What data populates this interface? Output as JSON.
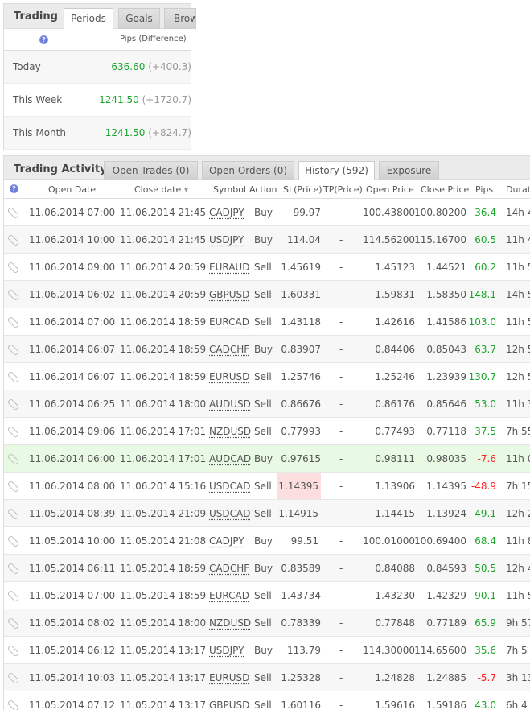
{
  "periods_panel": {
    "title": "Trading",
    "tabs": [
      "Periods",
      "Goals",
      "Brow"
    ],
    "active_tab": 0,
    "header": "Pips (Difference)",
    "rows": [
      {
        "label": "Today",
        "pips": "636.60",
        "diff": "(+400.3)"
      },
      {
        "label": "This Week",
        "pips": "1241.50",
        "diff": "(+1720.7)"
      },
      {
        "label": "This Month",
        "pips": "1241.50",
        "diff": "(+824.7)"
      }
    ]
  },
  "activity_panel": {
    "title": "Trading Activity",
    "tabs": [
      "Open Trades (0)",
      "Open Orders (0)",
      "History (592)",
      "Exposure"
    ],
    "active_tab": 2,
    "columns": [
      "Open Date",
      "Close date",
      "Symbol",
      "Action",
      "SL(Price)",
      "TP(Price)",
      "Open Price",
      "Close Price",
      "Pips",
      "Durati"
    ],
    "rows": [
      [
        "11.06.2014 07:00",
        "11.06.2014 21:45",
        "CADJPY",
        "Buy",
        "99.97",
        "-",
        "100.43800",
        "100.80200",
        "36.4",
        "14h 4"
      ],
      [
        "11.06.2014 10:00",
        "11.06.2014 21:45",
        "USDJPY",
        "Buy",
        "114.04",
        "-",
        "114.56200",
        "115.16700",
        "60.5",
        "11h 4"
      ],
      [
        "11.06.2014 09:00",
        "11.06.2014 20:59",
        "EURAUD",
        "Sell",
        "1.45619",
        "-",
        "1.45123",
        "1.44521",
        "60.2",
        "11h 5"
      ],
      [
        "11.06.2014 06:02",
        "11.06.2014 20:59",
        "GBPUSD",
        "Sell",
        "1.60331",
        "-",
        "1.59831",
        "1.58350",
        "148.1",
        "14h 5"
      ],
      [
        "11.06.2014 07:00",
        "11.06.2014 18:59",
        "EURCAD",
        "Sell",
        "1.43118",
        "-",
        "1.42616",
        "1.41586",
        "103.0",
        "11h 5"
      ],
      [
        "11.06.2014 06:07",
        "11.06.2014 18:59",
        "CADCHF",
        "Buy",
        "0.83907",
        "-",
        "0.84406",
        "0.85043",
        "63.7",
        "12h 5"
      ],
      [
        "11.06.2014 06:07",
        "11.06.2014 18:59",
        "EURUSD",
        "Sell",
        "1.25746",
        "-",
        "1.25246",
        "1.23939",
        "130.7",
        "12h 5"
      ],
      [
        "11.06.2014 06:25",
        "11.06.2014 18:00",
        "AUDUSD",
        "Sell",
        "0.86676",
        "-",
        "0.86176",
        "0.85646",
        "53.0",
        "11h 3"
      ],
      [
        "11.06.2014 09:06",
        "11.06.2014 17:01",
        "NZDUSD",
        "Sell",
        "0.77993",
        "-",
        "0.77493",
        "0.77118",
        "37.5",
        "7h 55"
      ],
      [
        "11.06.2014 06:00",
        "11.06.2014 17:01",
        "AUDCAD",
        "Buy",
        "0.97615",
        "-",
        "0.98111",
        "0.98035",
        "-7.6",
        "11h 0"
      ],
      [
        "11.06.2014 08:00",
        "11.06.2014 15:16",
        "USDCAD",
        "Sell",
        "1.14395",
        "-",
        "1.13906",
        "1.14395",
        "-48.9",
        "7h 15"
      ],
      [
        "11.05.2014 08:39",
        "11.05.2014 21:09",
        "USDCAD",
        "Sell",
        "1.14915",
        "-",
        "1.14415",
        "1.13924",
        "49.1",
        "12h 2"
      ],
      [
        "11.05.2014 10:00",
        "11.05.2014 21:08",
        "CADJPY",
        "Buy",
        "99.51",
        "-",
        "100.01000",
        "100.69400",
        "68.4",
        "11h 8"
      ],
      [
        "11.05.2014 06:11",
        "11.05.2014 18:59",
        "CADCHF",
        "Buy",
        "0.83589",
        "-",
        "0.84088",
        "0.84593",
        "50.5",
        "12h 4"
      ],
      [
        "11.05.2014 07:00",
        "11.05.2014 18:59",
        "EURCAD",
        "Sell",
        "1.43734",
        "-",
        "1.43230",
        "1.42329",
        "90.1",
        "11h 5"
      ],
      [
        "11.05.2014 08:02",
        "11.05.2014 18:00",
        "NZDUSD",
        "Sell",
        "0.78339",
        "-",
        "0.77848",
        "0.77189",
        "65.9",
        "9h 57"
      ],
      [
        "11.05.2014 06:12",
        "11.05.2014 13:17",
        "USDJPY",
        "Buy",
        "113.79",
        "-",
        "114.30000",
        "114.65600",
        "35.6",
        "7h 5"
      ],
      [
        "11.05.2014 10:03",
        "11.05.2014 13:17",
        "EURUSD",
        "Sell",
        "1.25328",
        "-",
        "1.24828",
        "1.24885",
        "-5.7",
        "3h 13"
      ],
      [
        "11.05.2014 07:12",
        "11.05.2014 13:17",
        "GBPUSD",
        "Sell",
        "1.60116",
        "-",
        "1.59616",
        "1.59186",
        "43.0",
        "6h 4"
      ]
    ]
  },
  "colors": {
    "positive": "#1aa52a",
    "negative": "#ff2222",
    "highlight_row": "#e8f9e4",
    "sl_hit": "#fcdede"
  }
}
